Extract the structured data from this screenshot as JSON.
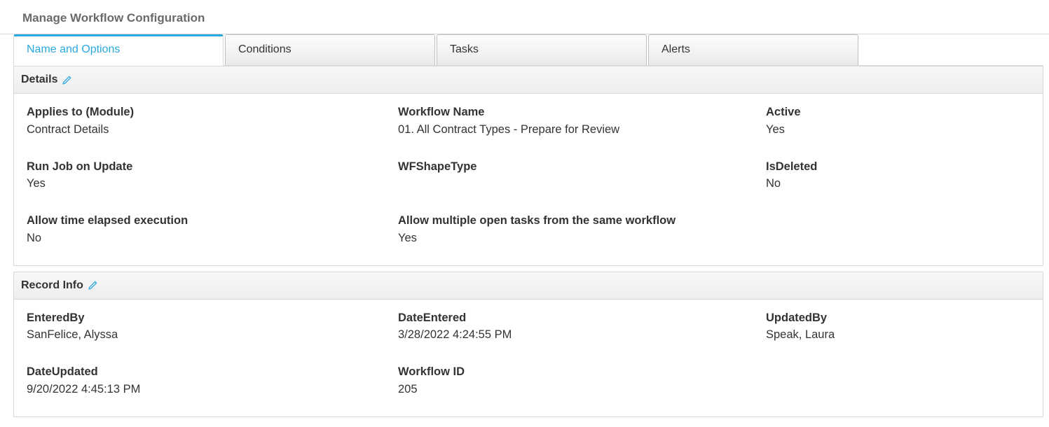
{
  "page_title": "Manage Workflow Configuration",
  "tabs": [
    {
      "label": "Name and Options",
      "active": true
    },
    {
      "label": "Conditions",
      "active": false
    },
    {
      "label": "Tasks",
      "active": false
    },
    {
      "label": "Alerts",
      "active": false
    }
  ],
  "details": {
    "header": "Details",
    "applies_to_label": "Applies to (Module)",
    "applies_to_value": "Contract Details",
    "workflow_name_label": "Workflow Name",
    "workflow_name_value": "01. All Contract Types - Prepare for Review",
    "active_label": "Active",
    "active_value": "Yes",
    "run_job_label": "Run Job on Update",
    "run_job_value": "Yes",
    "wfshape_label": "WFShapeType",
    "wfshape_value": "",
    "isdeleted_label": "IsDeleted",
    "isdeleted_value": "No",
    "allow_time_label": "Allow time elapsed execution",
    "allow_time_value": "No",
    "allow_multi_label": "Allow multiple open tasks from the same workflow",
    "allow_multi_value": "Yes"
  },
  "record_info": {
    "header": "Record Info",
    "enteredby_label": "EnteredBy",
    "enteredby_value": "SanFelice, Alyssa",
    "dateentered_label": "DateEntered",
    "dateentered_value": "3/28/2022 4:24:55 PM",
    "updatedby_label": "UpdatedBy",
    "updatedby_value": "Speak, Laura",
    "dateupdated_label": "DateUpdated",
    "dateupdated_value": "9/20/2022 4:45:13 PM",
    "workflowid_label": "Workflow ID",
    "workflowid_value": "205"
  }
}
